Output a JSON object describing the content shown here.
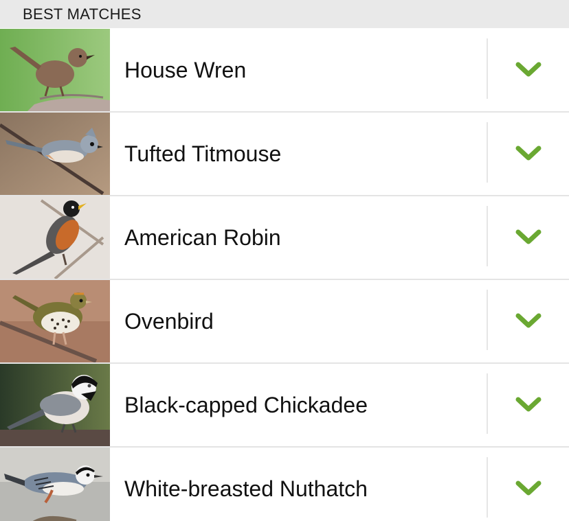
{
  "section": {
    "title": "BEST MATCHES"
  },
  "accent_color": "#6aa832",
  "matches": [
    {
      "name": "House Wren",
      "icon": "chevron-down-icon"
    },
    {
      "name": "Tufted Titmouse",
      "icon": "chevron-down-icon"
    },
    {
      "name": "American Robin",
      "icon": "chevron-down-icon"
    },
    {
      "name": "Ovenbird",
      "icon": "chevron-down-icon"
    },
    {
      "name": "Black-capped Chickadee",
      "icon": "chevron-down-icon"
    },
    {
      "name": "White-breasted Nuthatch",
      "icon": "chevron-down-icon"
    }
  ]
}
